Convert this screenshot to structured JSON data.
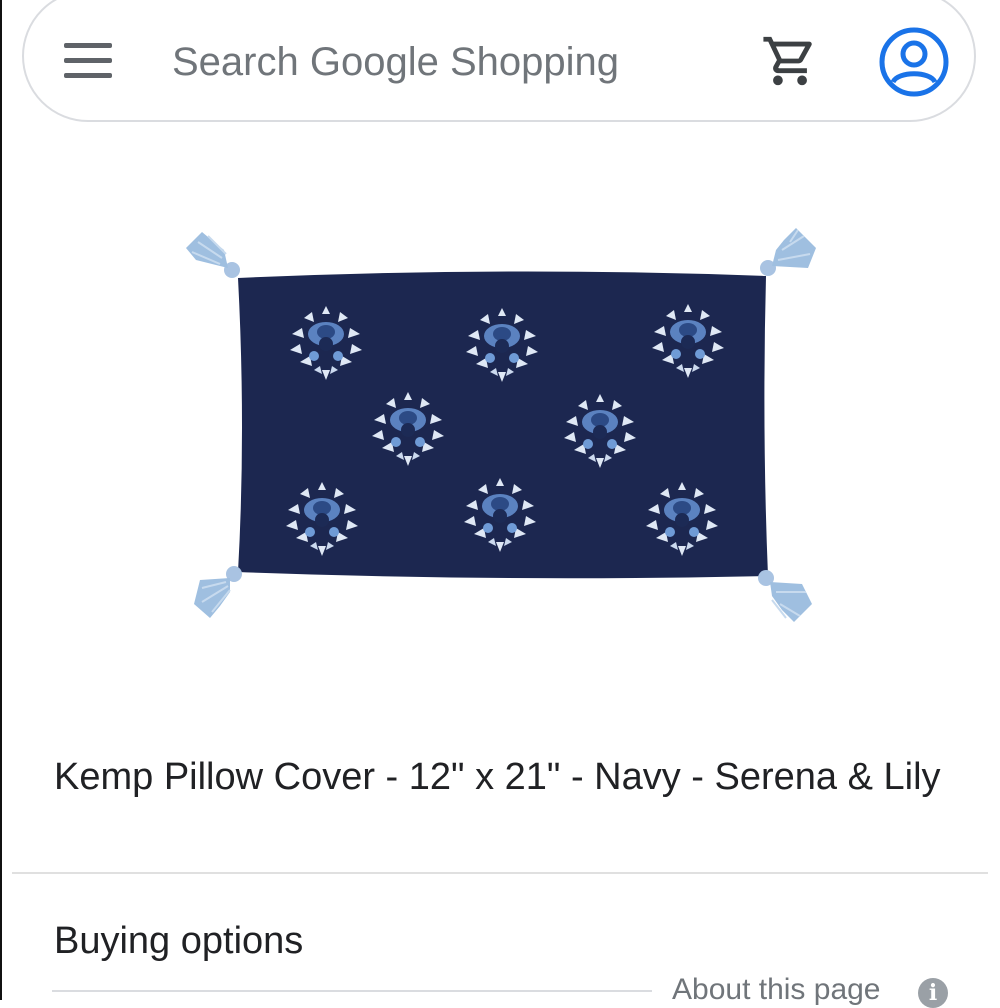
{
  "header": {
    "search_placeholder": "Search Google Shopping",
    "menu_icon": "hamburger-menu-icon",
    "cart_icon": "shopping-cart-icon",
    "account_icon": "account-circle-icon",
    "accent_color": "#1a73e8"
  },
  "product": {
    "image": "navy-embroidered-pillow-with-tassels",
    "title": "Kemp Pillow Cover - 12\" x 21\" - Navy - Serena & Lily"
  },
  "buying_options": {
    "heading": "Buying options",
    "about_link": "About this page",
    "info_icon": "info-icon"
  }
}
